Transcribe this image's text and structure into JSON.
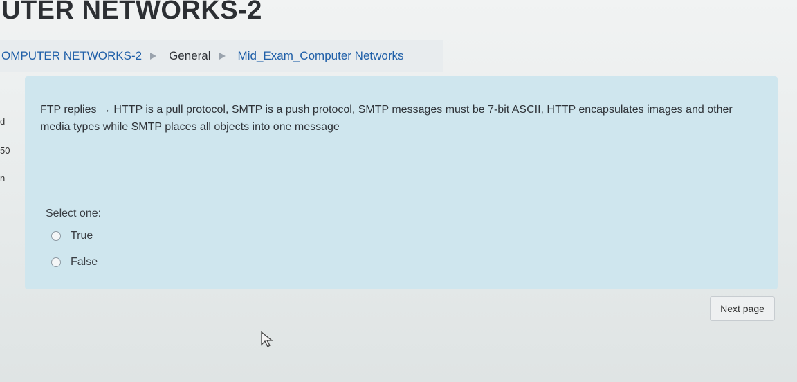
{
  "header": {
    "course_title": "UTER NETWORKS-2"
  },
  "breadcrumb": {
    "items": [
      {
        "label": "OMPUTER NETWORKS-2"
      },
      {
        "label": "General"
      },
      {
        "label": "Mid_Exam_Computer Networks"
      }
    ]
  },
  "side_info": {
    "line1": "d",
    "line2": "50",
    "line3": "n"
  },
  "question": {
    "text": "FTP replies → HTTP is a pull protocol, SMTP is a push protocol, SMTP messages must be 7-bit ASCII, HTTP encapsulates images and other media types while SMTP places all objects into one message",
    "select_label": "Select one:",
    "options": [
      {
        "label": "True"
      },
      {
        "label": "False"
      }
    ]
  },
  "navigation": {
    "next_label": "Next page"
  },
  "colors": {
    "question_background": "#cfe6ee",
    "link": "#1f5fa8"
  }
}
